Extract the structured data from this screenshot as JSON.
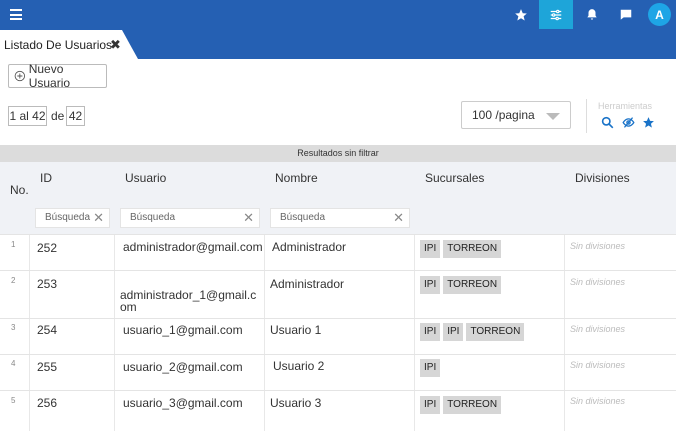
{
  "tab": {
    "title": "Listado De Usuarios",
    "close": "✖"
  },
  "toolbar": {
    "new_user_label": "Nuevo Usuario"
  },
  "pager": {
    "range": "1 al 42",
    "of_label": "de",
    "total": "42",
    "per_page": "100 /pagina"
  },
  "tools": {
    "label": "Herramientas"
  },
  "filter_status": "Resultados sin filtrar",
  "user_initial": "A",
  "columns": {
    "no": "No.",
    "id": "ID",
    "usuario": "Usuario",
    "nombre": "Nombre",
    "sucursales": "Sucursales",
    "divisiones": "Divisiones"
  },
  "search": {
    "placeholder": "Búsqueda"
  },
  "rows": [
    {
      "no": "1",
      "id": "252",
      "usuario": "administrador@gmail.com",
      "nombre": "Administrador",
      "sucursales": [
        "IPI",
        "TORREON"
      ],
      "divisiones": "Sin divisiones"
    },
    {
      "no": "2",
      "id": "253",
      "usuario": "administrador_1@gmail.com",
      "nombre": "Administrador",
      "sucursales": [
        "IPI",
        "TORREON"
      ],
      "divisiones": "Sin divisiones"
    },
    {
      "no": "3",
      "id": "254",
      "usuario": "usuario_1@gmail.com",
      "nombre": "Usuario 1",
      "sucursales": [
        "IPI",
        "IPI",
        "TORREON"
      ],
      "divisiones": "Sin divisiones"
    },
    {
      "no": "4",
      "id": "255",
      "usuario": "usuario_2@gmail.com",
      "nombre": "Usuario 2",
      "sucursales": [
        "IPI"
      ],
      "divisiones": "Sin divisiones"
    },
    {
      "no": "5",
      "id": "256",
      "usuario": "usuario_3@gmail.com",
      "nombre": "Usuario 3",
      "sucursales": [
        "IPI",
        "TORREON"
      ],
      "divisiones": "Sin divisiones"
    }
  ],
  "colors": {
    "header_blue": "#2560b3",
    "active_cyan": "#1ea5d9",
    "link_blue": "#1a73c8"
  }
}
